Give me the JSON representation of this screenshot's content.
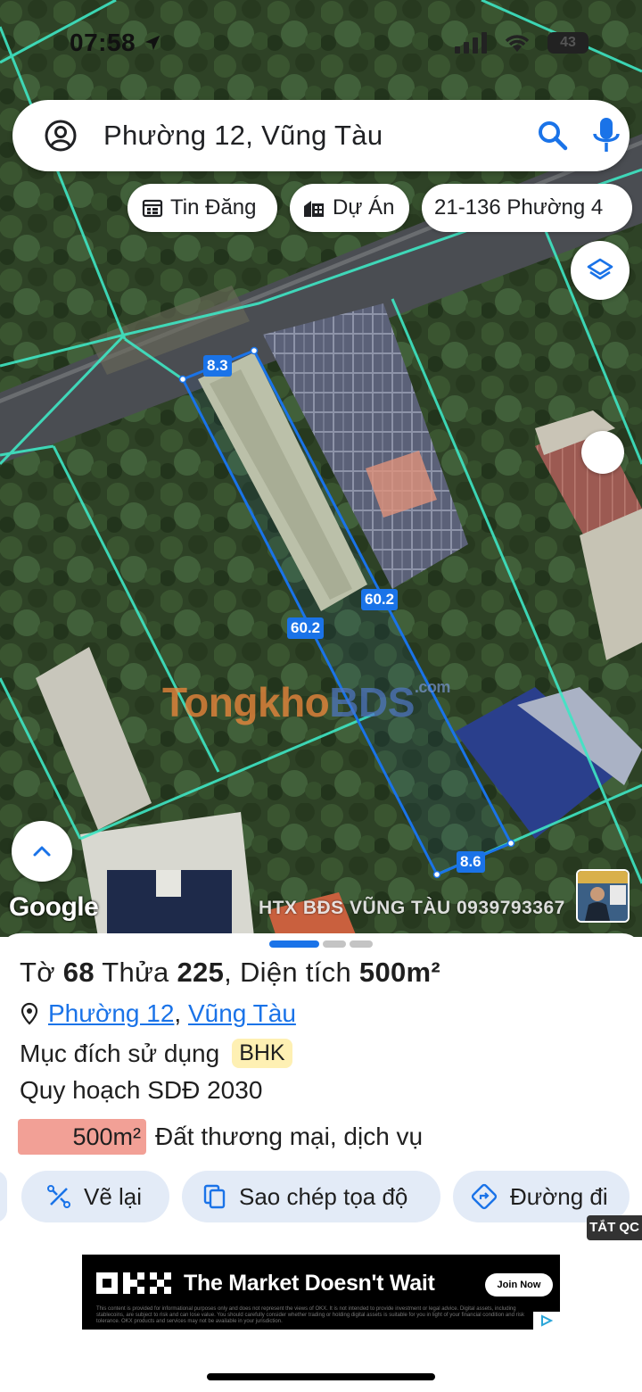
{
  "status": {
    "time": "07:58",
    "battery": "43"
  },
  "search": {
    "text": "Phường 12, Vũng Tàu"
  },
  "chips": [
    {
      "label": "Tin Đăng"
    },
    {
      "label": "Dự Án"
    },
    {
      "label": "21-136 Phường 4"
    }
  ],
  "map": {
    "dimensions": {
      "top": "8.3",
      "right": "60.2",
      "left": "60.2",
      "bottom": "8.6"
    },
    "google": "Google",
    "watermark_main": "Tongkho",
    "watermark_accent": "BDS",
    "watermark_sub": ".com",
    "overlay_text": "HTX BĐS VŨNG TÀU 0939793367"
  },
  "sheet": {
    "title_prefix": "Tờ ",
    "sheet_no": "68",
    "parcel_label": " Thửa ",
    "parcel_no": "225",
    "area_label": ", Diện tích ",
    "area_value": "500m²",
    "location_ward": "Phường 12",
    "location_sep": ", ",
    "location_city": "Vũng Tàu",
    "purpose_label": "Mục đích sử dụng",
    "purpose_code": "BHK",
    "plan_label": "Quy hoạch SDĐ 2030",
    "zone_area": "500m²",
    "zone_type": "Đất thương mại, dịch vụ",
    "zone_color": "#f2a096",
    "actions": [
      {
        "label": "Vẽ lại",
        "icon": "redraw-icon"
      },
      {
        "label": "Sao chép tọa độ",
        "icon": "copy-icon"
      },
      {
        "label": "Đường đi",
        "icon": "directions-icon"
      }
    ]
  },
  "ad": {
    "tag": "TẮT QC",
    "headline": "The Market Doesn't Wait",
    "cta": "Join Now",
    "fine_print": "This content is provided for informational purposes only and does not represent the views of OKX. It is not intended to provide investment or legal advice. Digital assets, including stablecoins, are subject to risk and can lose value. You should carefully consider whether trading or holding digital assets is suitable for you in light of your financial condition and risk tolerance. OKX products and services may not be available in your jurisdiction."
  },
  "colors": {
    "accent": "#1a73e8",
    "parcel_line": "#3ee6c4",
    "action_bg": "#e3ebf7"
  }
}
